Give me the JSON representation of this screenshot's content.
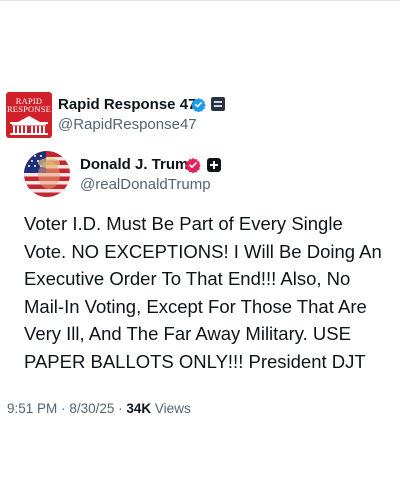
{
  "outer_tweet": {
    "display_name": "Rapid Response 47",
    "handle": "@RapidResponse47",
    "avatar_text": [
      "RAPID",
      "RESPONSE"
    ],
    "verified_icon": "verified-badge-icon",
    "affiliation_icon": "affiliation-badge-icon"
  },
  "quoted_post": {
    "display_name": "Donald J. Trump",
    "handle": "@realDonaldTrump",
    "verified_icon": "verified-badge-icon",
    "affiliation_icon": "plus-badge-icon",
    "body_lines": [
      "Voter I.D. Must Be Part of Every Single",
      "Vote. NO EXCEPTIONS! I Will Be Doing An",
      "Executive Order To That End!!! Also, No",
      "Mail-In Voting, Except For Those That Are",
      "Very Ill, And The Far Away Military. USE",
      "PAPER BALLOTS ONLY!!! President DJT"
    ]
  },
  "meta": {
    "time": "9:51 PM",
    "separator": "·",
    "date": "8/30/25",
    "views_count": "34K",
    "views_label": "Views"
  },
  "colors": {
    "brand_red": "#d0202a",
    "verified_blue": "#1d9bf0",
    "verified_pink": "#e0245e",
    "secondary_text": "#536471"
  }
}
